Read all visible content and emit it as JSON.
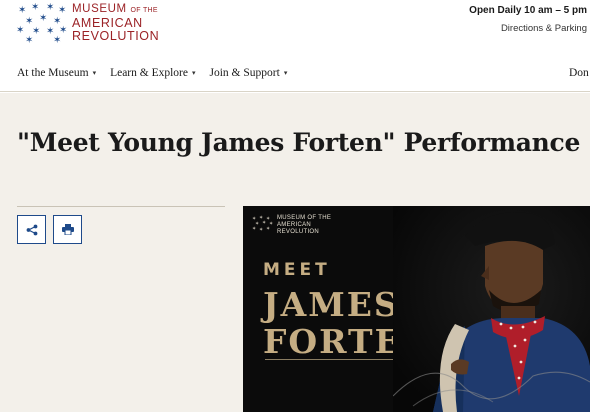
{
  "logo": {
    "line1": "MUSEUM",
    "line1_small": "OF THE",
    "line2": "AMERICAN",
    "line3": "REVOLUTION"
  },
  "utility": {
    "hours": "Open Daily 10 am – 5 pm",
    "directions": "Directions & Parking"
  },
  "nav": {
    "items": [
      {
        "label": "At the Museum"
      },
      {
        "label": "Learn & Explore"
      },
      {
        "label": "Join & Support"
      }
    ],
    "donate": "Don"
  },
  "main": {
    "title": "\"Meet Young James Forten\" Performance"
  },
  "promo": {
    "logo_line1": "MUSEUM OF THE",
    "logo_line2": "AMERICAN",
    "logo_line3": "REVOLUTION",
    "meet": "MEET",
    "name_line1": "JAMES",
    "name_line2": "FORTEN"
  },
  "colors": {
    "brand_red": "#9b2226",
    "button_blue": "#1e4a8a",
    "promo_gold": "#c5ad83",
    "page_bg": "#f3f0ea"
  },
  "icons": {
    "logo": "stars-icon",
    "share": "share-icon",
    "print": "print-icon",
    "caret": "chevron-down-icon"
  }
}
